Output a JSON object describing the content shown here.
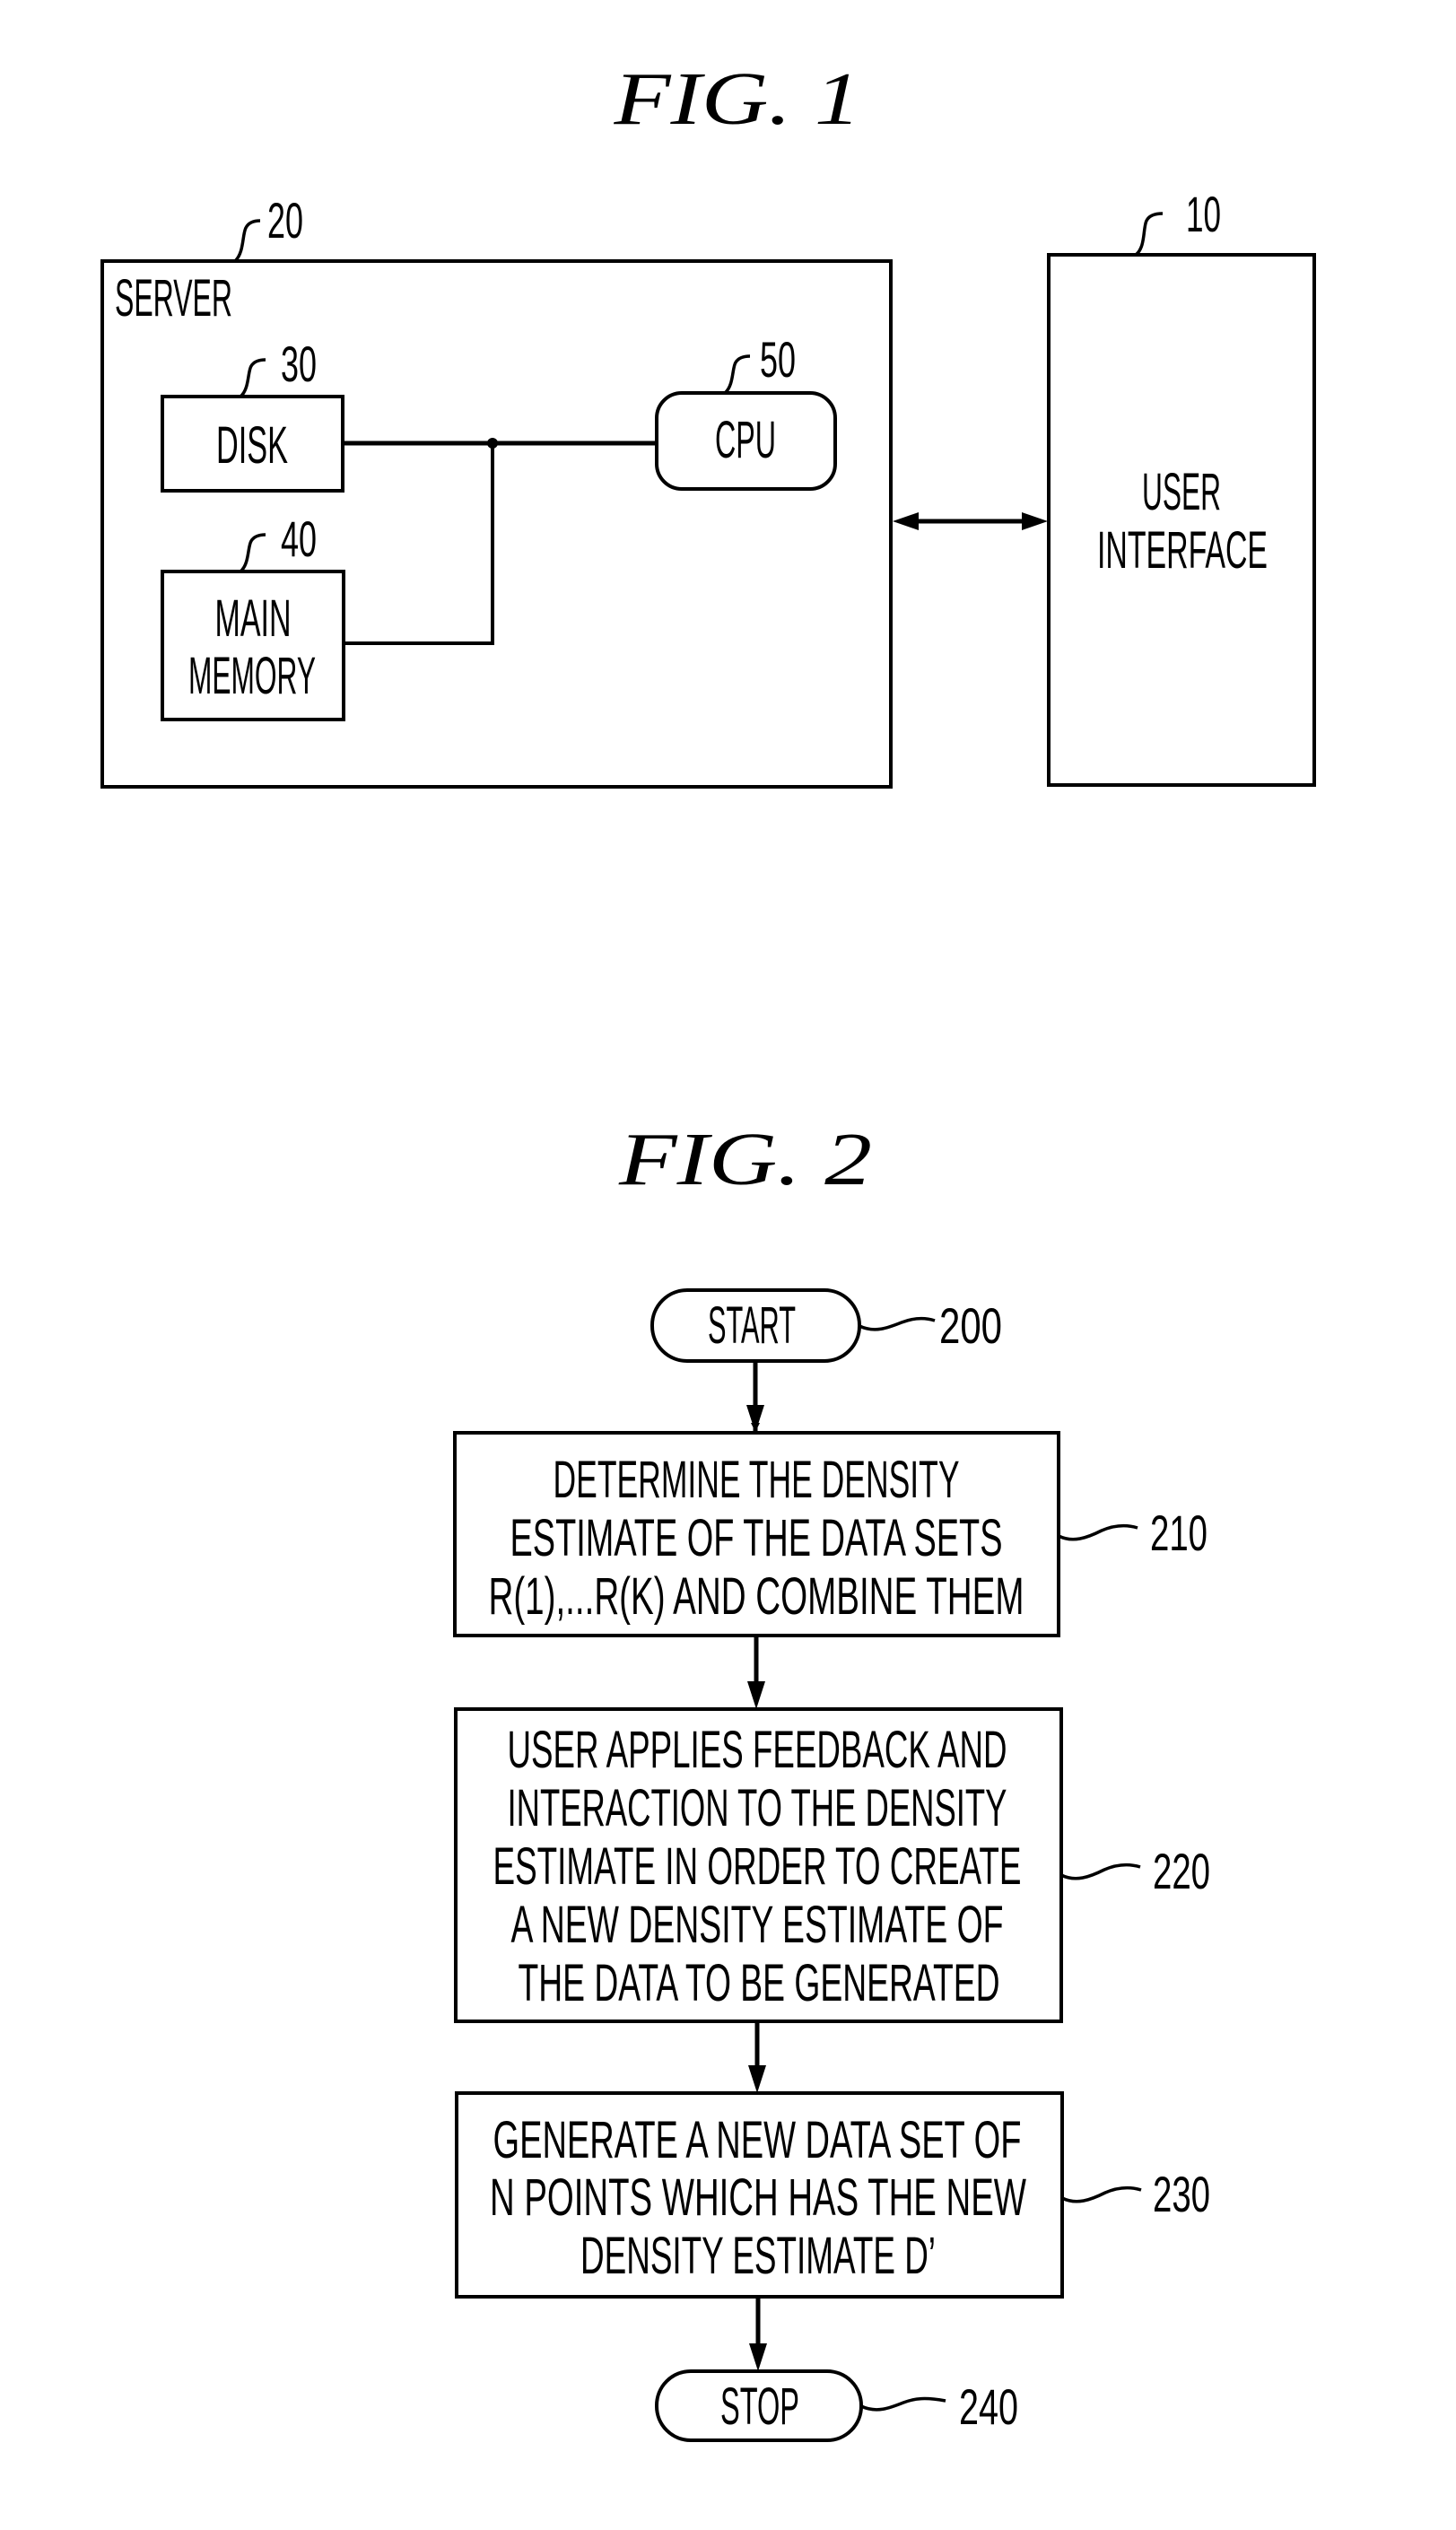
{
  "fig1": {
    "title": "FIG. 1",
    "server": {
      "ref": "20",
      "label": "SERVER"
    },
    "disk": {
      "ref": "30",
      "label": "DISK"
    },
    "main_memory": {
      "ref": "40",
      "label_lines": [
        "MAIN",
        "MEMORY"
      ]
    },
    "cpu": {
      "ref": "50",
      "label": "CPU"
    },
    "user_interface": {
      "ref": "10",
      "label_lines": [
        "USER",
        "INTERFACE"
      ]
    },
    "connections": [
      {
        "from": "DISK",
        "to": "CPU",
        "type": "line"
      },
      {
        "from": "MAIN MEMORY",
        "to": "CPU",
        "type": "line"
      },
      {
        "from": "SERVER",
        "to": "USER INTERFACE",
        "type": "bidirectional-arrow"
      }
    ]
  },
  "fig2": {
    "title": "FIG. 2",
    "start": {
      "ref": "200",
      "label": "START"
    },
    "steps": [
      {
        "ref": "210",
        "lines": [
          "DETERMINE THE DENSITY",
          "ESTIMATE OF THE DATA SETS",
          "R(1),...R(K) AND COMBINE THEM"
        ]
      },
      {
        "ref": "220",
        "lines": [
          "USER APPLIES FEEDBACK AND",
          "INTERACTION TO THE DENSITY",
          "ESTIMATE IN ORDER TO CREATE",
          "A NEW DENSITY ESTIMATE OF",
          "THE DATA TO BE GENERATED"
        ]
      },
      {
        "ref": "230",
        "lines": [
          "GENERATE A NEW DATA SET OF",
          "N POINTS WHICH HAS THE NEW",
          "DENSITY ESTIMATE D’"
        ]
      }
    ],
    "stop": {
      "ref": "240",
      "label": "STOP"
    }
  }
}
